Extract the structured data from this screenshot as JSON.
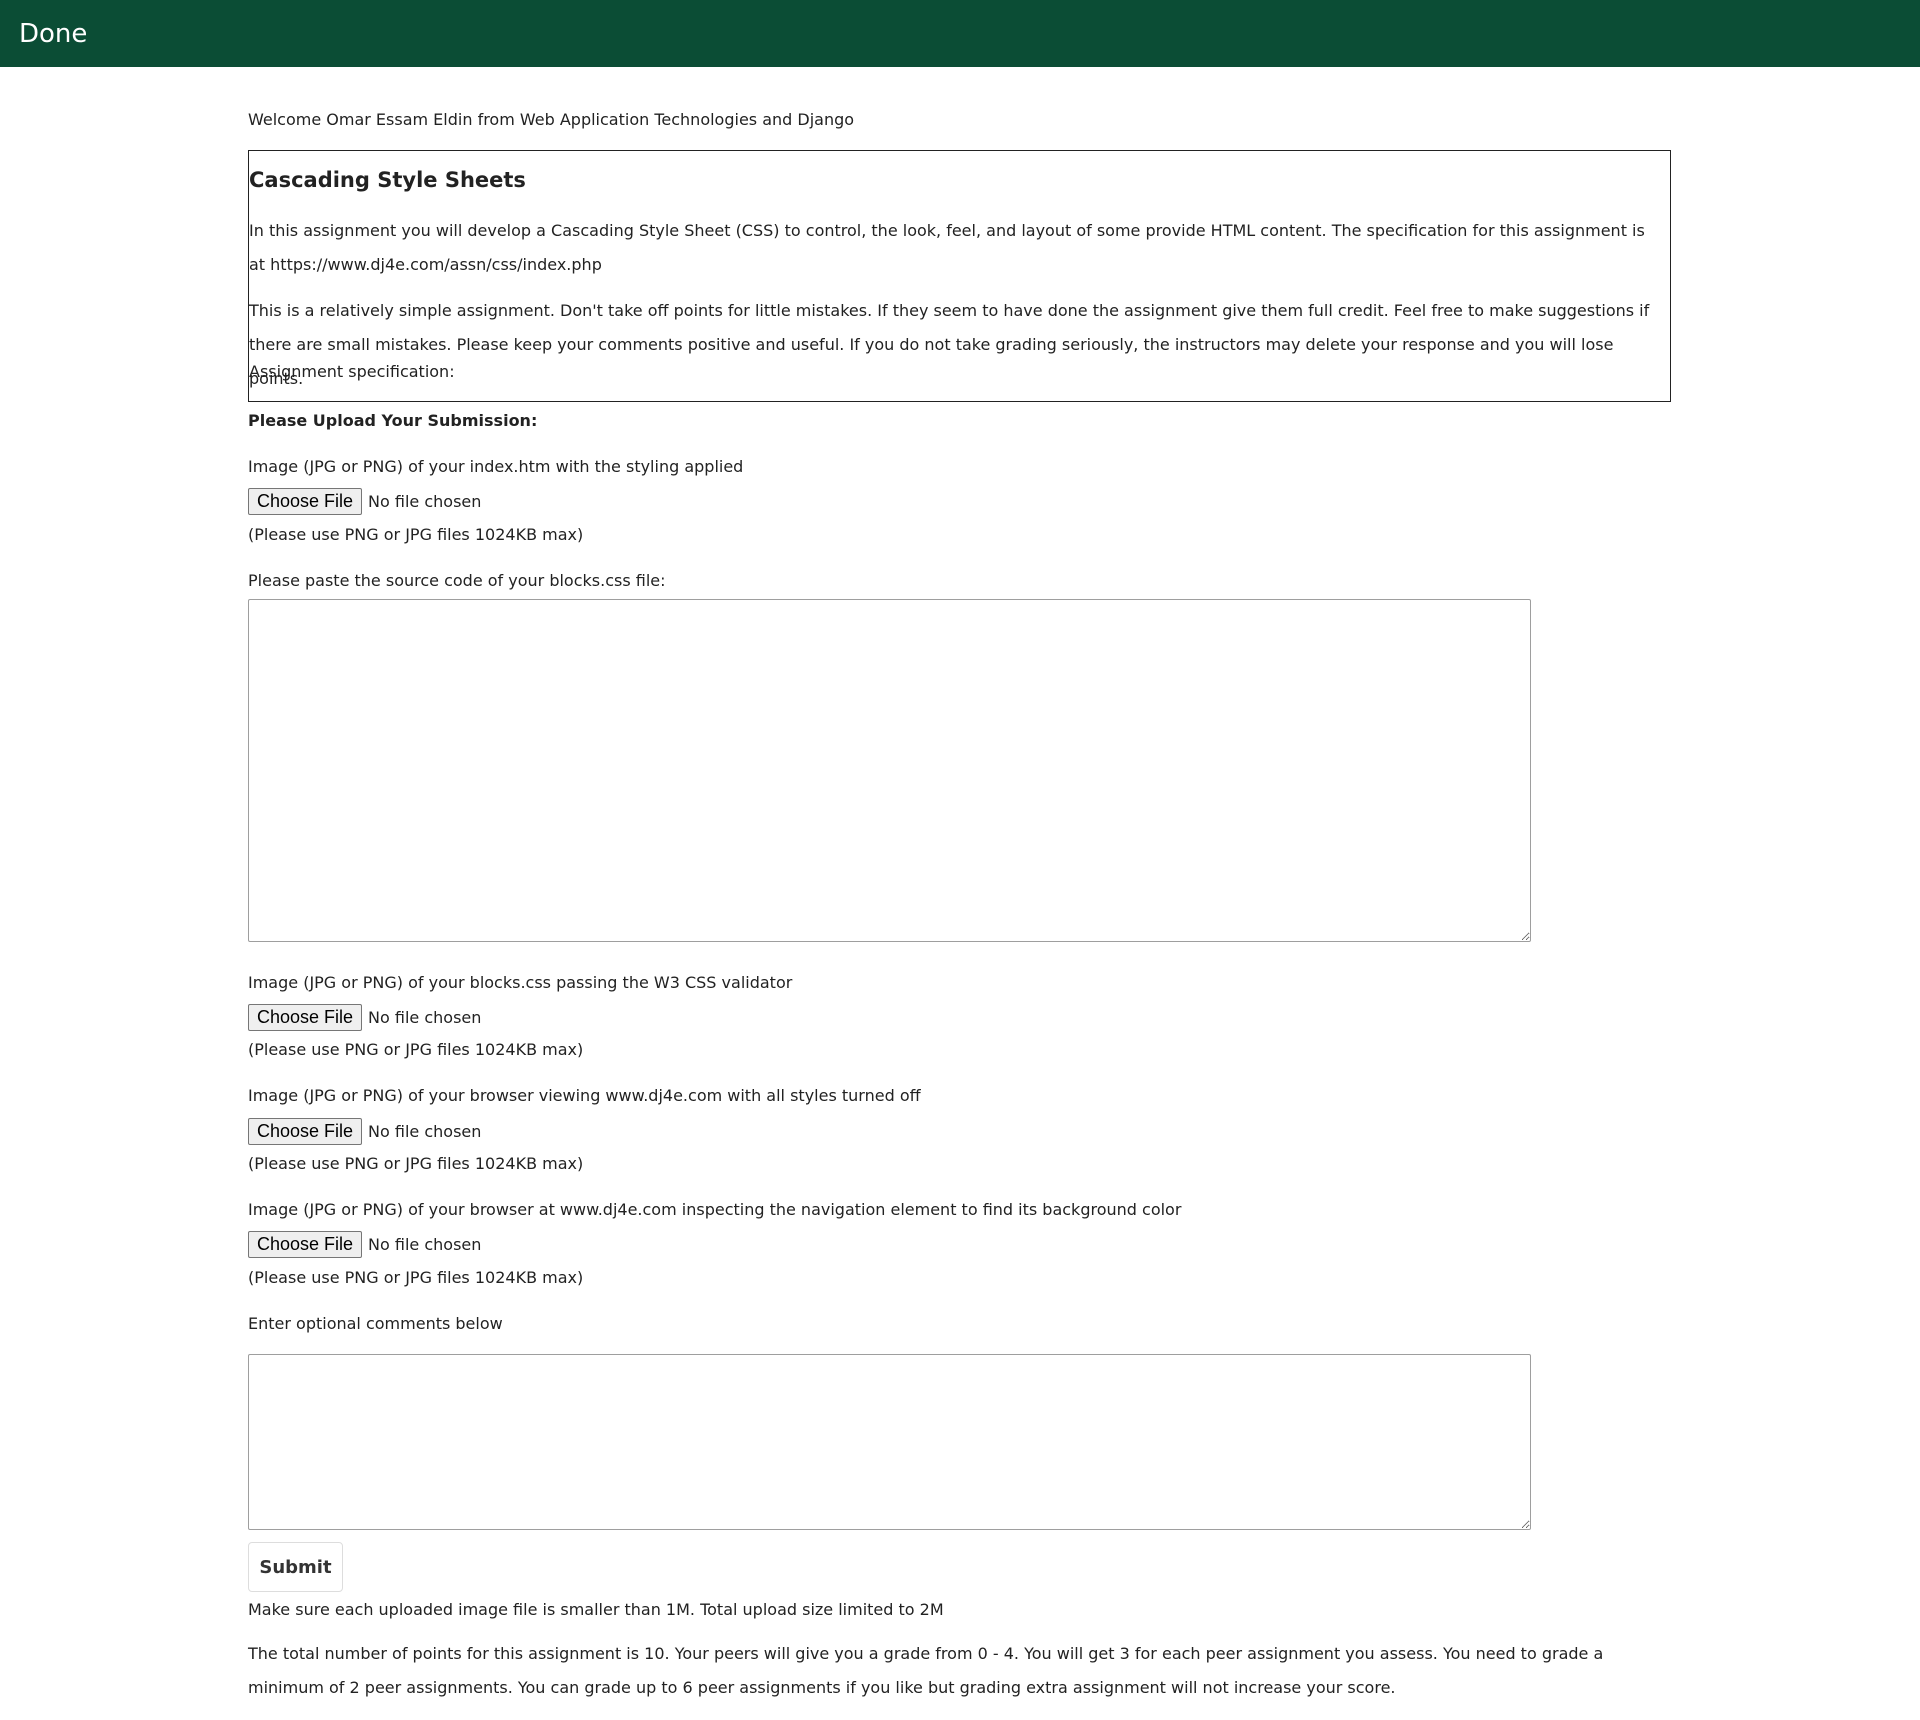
{
  "header": {
    "done_label": "Done"
  },
  "welcome": "Welcome Omar Essam Eldin from Web Application Technologies and Django",
  "assignment": {
    "title": "Cascading Style Sheets",
    "description": "In this assignment you will develop a Cascading Style Sheet (CSS) to control, the look, feel, and layout of some provide HTML content. The specification for this assignment is at https://www.dj4e.com/assn/css/index.php",
    "grading_note": "This is a relatively simple assignment. Don't take off points for little mistakes. If they seem to have done the assignment give them full credit. Feel free to make suggestions if there are small mistakes. Please keep your comments positive and useful. If you do not take grading seriously, the instructors may delete your response and you will lose points.",
    "spec_label": "Assignment specification:"
  },
  "form": {
    "heading": "Please Upload Your Submission:",
    "file_button_label": "Choose File",
    "no_file_text": "No file chosen",
    "file_note": "(Please use PNG or JPG files 1024KB max)",
    "image1_label": "Image (JPG or PNG) of your index.htm with the styling applied",
    "code_label": "Please paste the source code of your blocks.css file:",
    "code_value": "",
    "image2_label": "Image (JPG or PNG) of your blocks.css passing the W3 CSS validator",
    "image3_label": "Image (JPG or PNG) of your browser viewing www.dj4e.com with all styles turned off",
    "image4_label": "Image (JPG or PNG) of your browser at www.dj4e.com inspecting the navigation element to find its background color",
    "comments_label": "Enter optional comments below",
    "comments_value": "",
    "submit_label": "Submit"
  },
  "footer": {
    "size_note": "Make sure each uploaded image file is smaller than 1M. Total upload size limited to 2M",
    "points_note": "The total number of points for this assignment is 10. Your peers will give you a grade from 0 - 4. You will get 3 for each peer assignment you assess. You need to grade a minimum of 2 peer assignments. You can grade up to 6 peer assignments if you like but grading extra assignment will not increase your score."
  },
  "colors": {
    "header_bg": "#0b4d35",
    "header_text": "#ffffff"
  }
}
